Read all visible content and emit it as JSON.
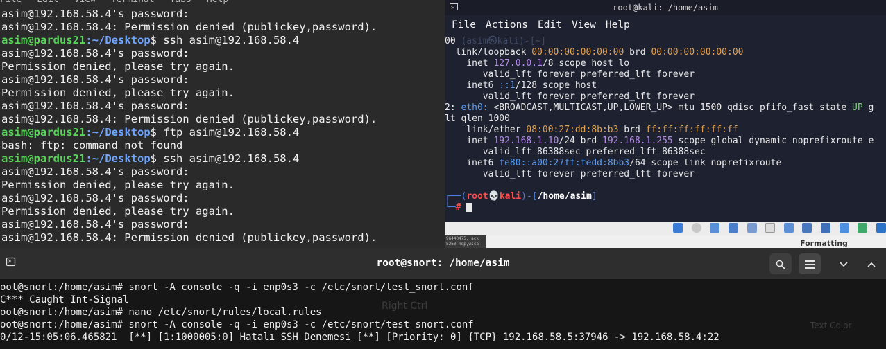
{
  "left_terminal": {
    "menu": [
      "File",
      "Edit",
      "View",
      "Terminal",
      "Tabs",
      "Help"
    ],
    "lines": [
      "asim@192.168.58.4's password:",
      "asim@192.168.58.4: Permission denied (publickey,password).",
      {
        "user": "asim@pardus21",
        "path": ":~/Desktop",
        "cmd": "$ ssh asim@192.168.58.4"
      },
      "asim@192.168.58.4's password:",
      "Permission denied, please try again.",
      "asim@192.168.58.4's password:",
      "Permission denied, please try again.",
      "asim@192.168.58.4's password:",
      "asim@192.168.58.4: Permission denied (publickey,password).",
      {
        "user": "asim@pardus21",
        "path": ":~/Desktop",
        "cmd": "$ ftp asim@192.168.58.4"
      },
      "bash: ftp: command not found",
      {
        "user": "asim@pardus21",
        "path": ":~/Desktop",
        "cmd": "$ ssh asim@192.168.58.4"
      },
      "asim@192.168.58.4's password:",
      "Permission denied, please try again.",
      "asim@192.168.58.4's password:",
      "Permission denied, please try again.",
      "asim@192.168.58.4's password:",
      "asim@192.168.58.4: Permission denied (publickey,password)."
    ]
  },
  "kali_terminal": {
    "title": "root@kali: /home/asim",
    "menu": [
      "File",
      "Actions",
      "Edit",
      "View",
      "Help"
    ],
    "lines": [
      [
        {
          "t": "00 "
        },
        {
          "t": "(asim㉿kali)-[~]",
          "c": "kd"
        }
      ],
      [
        {
          "t": "  ",
          "c": "kd"
        },
        {
          "t": "link/loopback "
        },
        {
          "t": "00:00:00:00:00:00",
          "c": "ko"
        },
        {
          "t": " brd "
        },
        {
          "t": "00:00:00:00:00:00",
          "c": "ko"
        }
      ],
      [
        {
          "t": "    inet "
        },
        {
          "t": "127.0.0.1",
          "c": "kp"
        },
        {
          "t": "/8 scope host lo"
        }
      ],
      [
        {
          "t": "       valid_lft forever preferred_lft forever"
        }
      ],
      [
        {
          "t": "    inet6 "
        },
        {
          "t": "::1",
          "c": "kb"
        },
        {
          "t": "/128 scope host"
        }
      ],
      [
        {
          "t": "       valid_lft forever preferred_lft forever"
        }
      ],
      [
        {
          "t": "2: "
        },
        {
          "t": "eth0:",
          "c": "kb"
        },
        {
          "t": " <BROADCAST,MULTICAST,UP,LOWER_UP> mtu 1500 qdisc pfifo_fast state "
        },
        {
          "t": "UP",
          "c": "kg"
        },
        {
          "t": " g"
        }
      ],
      [
        {
          "t": "lt qlen 1000"
        }
      ],
      [
        {
          "t": "    link/ether "
        },
        {
          "t": "08:00:27:dd:8b:b3",
          "c": "ko"
        },
        {
          "t": " brd "
        },
        {
          "t": "ff:ff:ff:ff:ff:ff",
          "c": "ko"
        }
      ],
      [
        {
          "t": "    inet "
        },
        {
          "t": "192.168.1.10",
          "c": "kp"
        },
        {
          "t": "/24 brd "
        },
        {
          "t": "192.168.1.255",
          "c": "kp"
        },
        {
          "t": " scope global dynamic noprefixroute e"
        }
      ],
      [
        {
          "t": "       valid_lft 86388sec preferred_lft 86388sec"
        }
      ],
      [
        {
          "t": "    inet6 "
        },
        {
          "t": "fe80::a00:27ff:fedd:8bb3",
          "c": "kb"
        },
        {
          "t": "/64 scope link noprefixroute"
        }
      ],
      [
        {
          "t": "       valid_lft forever preferred_lft forever"
        }
      ],
      [
        {
          "t": ""
        }
      ]
    ],
    "prompt": {
      "open": "┌──(",
      "user": "root",
      "skull": "💀",
      "host": "kali",
      "mid": ")-[",
      "path": "/home/asim",
      "close": "]",
      "line2": "└─",
      "hash": "#"
    }
  },
  "strip": {
    "fragment": "96440475, ack\n5260 nop,wsca",
    "formatting": "Formatting"
  },
  "snort_terminal": {
    "title": "root@snort: /home/asim",
    "lines": [
      "oot@snort:/home/asim# snort -A console -q -i enp0s3 -c /etc/snort/test_snort.conf",
      "C*** Caught Int-Signal",
      "oot@snort:/home/asim# nano /etc/snort/rules/local.rules",
      "oot@snort:/home/asim# snort -A console -q -i enp0s3 -c /etc/snort/test_snort.conf",
      "0/12-15:05:06.465821  [**] [1:1000005:0] Hatalı SSH Denemesi [**] [Priority: 0] {TCP} 192.168.58.5:37946 -> 192.168.58.4:22"
    ],
    "ghost_right_ctrl": "Right Ctrl",
    "ghost_text_color": "Text Color"
  },
  "colors": {
    "left_bg": "#2a2a2a",
    "prompt_green": "#5ad45a",
    "prompt_blue": "#6fa6ff",
    "kali_bg": "#1e2230",
    "snort_bg": "#161616",
    "header_bg": "#2e2e2e"
  },
  "icons": [
    "new-tab-icon",
    "search-icon",
    "hamburger-menu-icon",
    "chevron-down-icon",
    "chevron-up-icon",
    "terminal-icon"
  ]
}
